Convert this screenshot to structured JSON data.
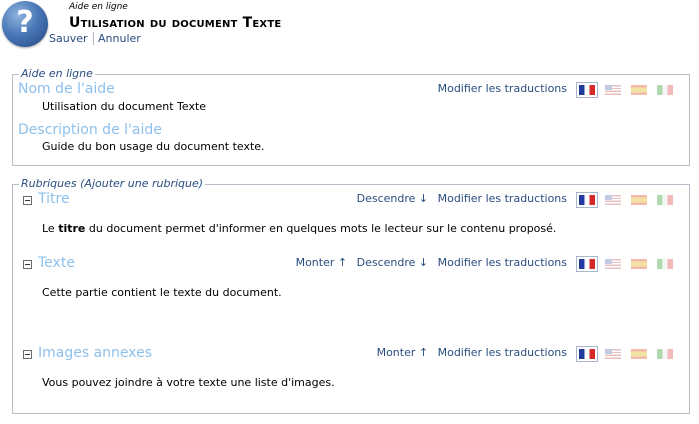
{
  "header": {
    "logo_glyph": "?",
    "kicker": "Aide en ligne",
    "title": "Utilisation du document Texte",
    "save_label": "Sauver",
    "cancel_label": "Annuler"
  },
  "info_box": {
    "legend": "Aide en ligne",
    "name_label": "Nom de l'aide",
    "name_value": "Utilisation du document Texte",
    "description_label": "Description de l'aide",
    "description_value": "Guide du bon usage du document texte.",
    "edit_translations_label": "Modifier les traductions"
  },
  "sections_box": {
    "legend": "Rubriques (Ajouter une rubrique)",
    "sections": [
      {
        "title": "Titre",
        "move_down_label": "Descendre ↓",
        "edit_translations_label": "Modifier les traductions",
        "text_before": "Le ",
        "text_bold": "titre",
        "text_after": " du document permet d'informer en quelques mots le lecteur sur le contenu proposé."
      },
      {
        "title": "Texte",
        "move_up_label": "Monter ↑",
        "move_down_label": "Descendre ↓",
        "edit_translations_label": "Modifier les traductions",
        "text": "Cette partie contient le texte du document."
      },
      {
        "title": "Images annexes",
        "move_up_label": "Monter ↑",
        "edit_translations_label": "Modifier les traductions",
        "text": "Vous pouvez joindre à votre texte une liste d'images."
      }
    ]
  },
  "languages": [
    "french-flag-icon",
    "english-flag-icon",
    "spanish-flag-icon",
    "italian-flag-icon"
  ],
  "colors": {
    "link": "#2a4d7f",
    "field_title": "#8ec0ec",
    "border": "#b7bcc8",
    "flag_fr_blue": "#1f3c9c",
    "flag_fr_red": "#d62828"
  }
}
